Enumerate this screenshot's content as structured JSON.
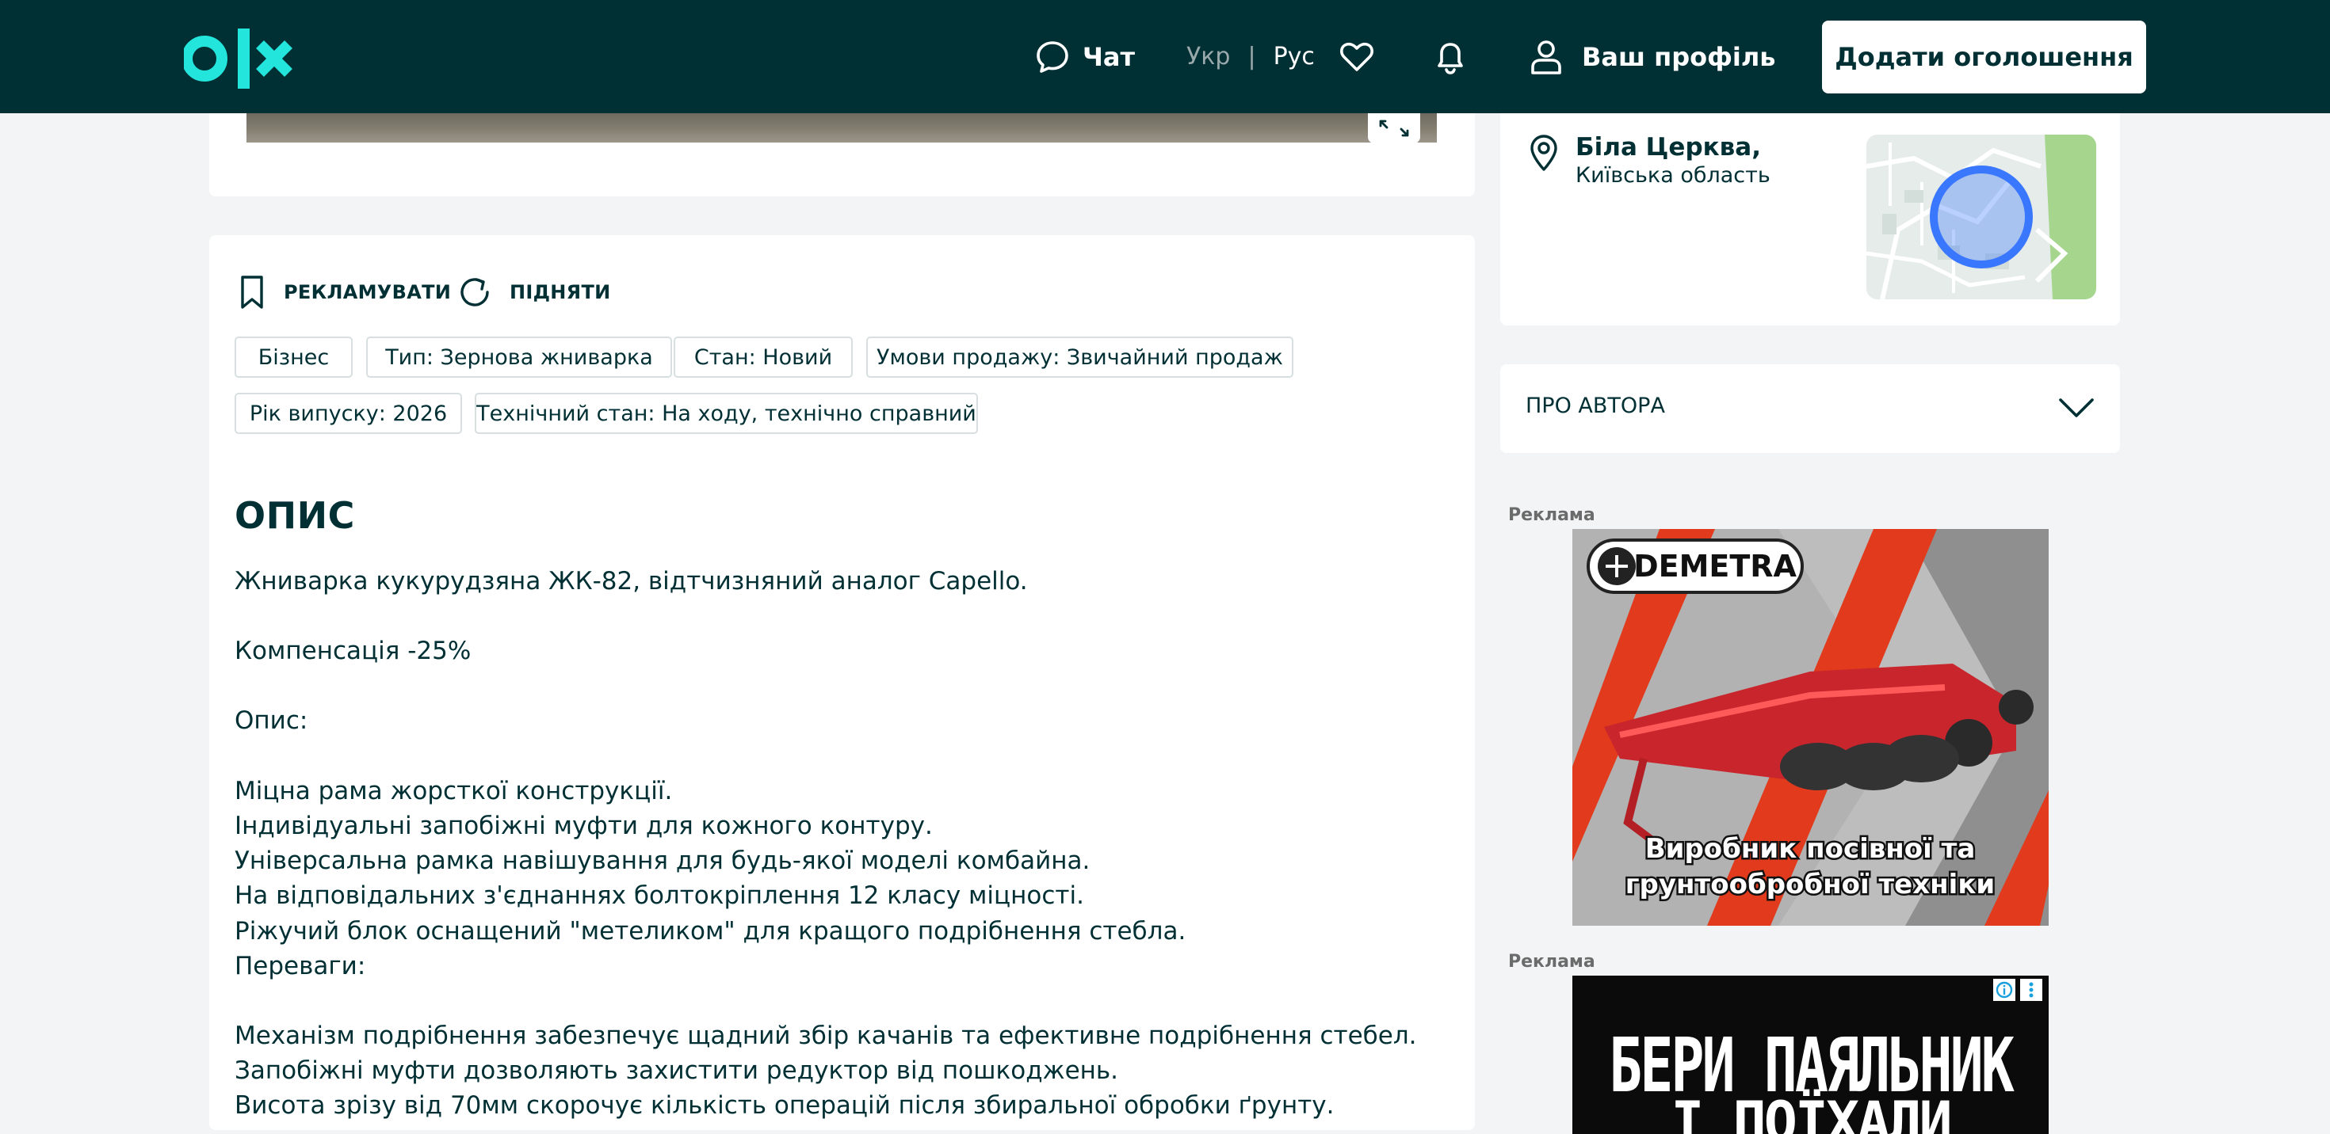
{
  "header": {
    "chat_label": "Чат",
    "lang_ukr": "Укр",
    "lang_sep": "|",
    "lang_rus": "Рус",
    "profile_label": "Ваш профіль",
    "add_button": "Додати оголошення"
  },
  "actions": {
    "promote": "РЕКЛАМУВАТИ",
    "raise": "ПІДНЯТИ"
  },
  "tags": [
    "Бізнес",
    "Тип: Зернова жниварка",
    "Стан: Новий",
    "Умови продажу: Звичайний продаж",
    "Рік випуску: 2026",
    "Технічний стан: На ходу, технічно справний"
  ],
  "description": {
    "title": "ОПИС",
    "lines": [
      "Жниварка кукурудзяна ЖК-82, відтчизняний аналог Capello.",
      "Компенсація -25%",
      "Опис:",
      "Міцна рама жорсткої конструкції.",
      "Індивідуальні запобіжні муфти для кожного контуру.",
      "Універсальна рамка навішування для будь-якої моделі комбайна.",
      "На відповідальних з'єднаннях болтокріплення 12 класу міцності.",
      "Ріжучий блок оснащений \"метеликом\" для кращого подрібнення стебла.",
      "Переваги:",
      "Механізм подрібнення забезпечує щадний збір качанів та ефективне подрібнення стебел.",
      "Запобіжні муфти дозволяють захистити редуктор від пошкоджень.",
      "Висота зрізу від 70мм скорочує кількість операцій після збиральної обробки ґрунту."
    ]
  },
  "location": {
    "city": "Біла Церква,",
    "region": "Київська область"
  },
  "author": {
    "label": "ПРО АВТОРА"
  },
  "ads": {
    "label": "Реклама",
    "ad1_brand": "DEMETRA",
    "ad1_line1": "Виробник посівної та",
    "ad1_line2": "грунтообробної техніки",
    "ad2_line1": "БЕРИ ПАЯЛЬНИК",
    "ad2_line2": "І ПОЇХАЛИ"
  },
  "colors": {
    "header_bg": "#002f34",
    "logo": "#23e5db",
    "page_bg": "#f2f4f5",
    "text": "#002f34",
    "map_pin": "#3a77ff"
  }
}
